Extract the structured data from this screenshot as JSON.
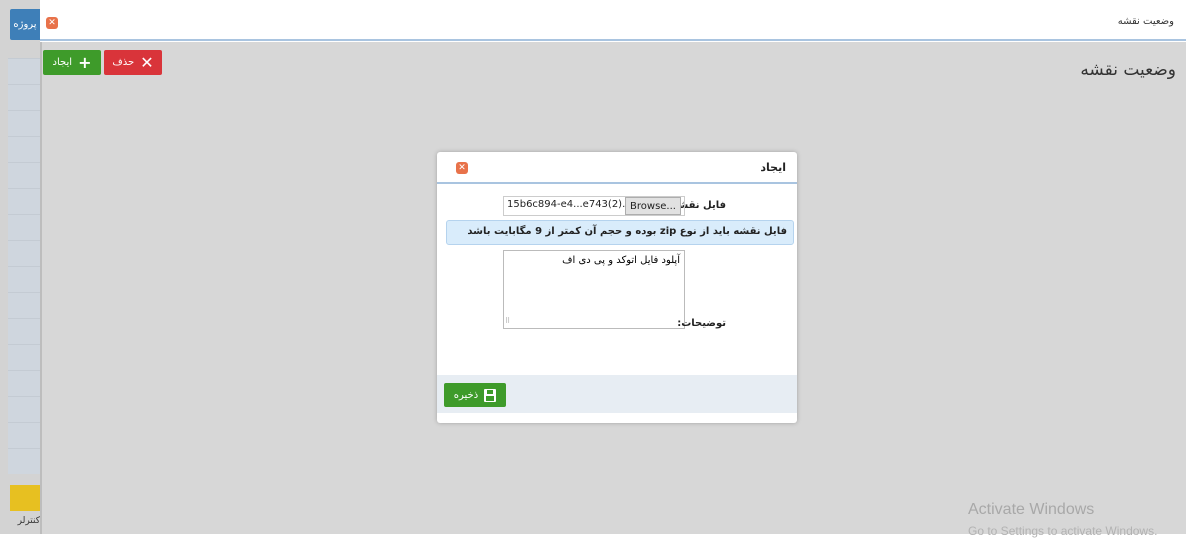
{
  "sidebar": {
    "project_tab": "پروژه",
    "bottom_label": "کنترلر"
  },
  "tab": {
    "title": "وضعیت نقشه"
  },
  "page": {
    "title": "وضعیت نقشه"
  },
  "toolbar": {
    "add_label": "ایجاد",
    "delete_label": "حذف"
  },
  "modal": {
    "title": "ایجاد",
    "file_label": "فایل نقشه:",
    "file_name": "15b6c894-e4...e743(2).zip",
    "browse_label": "Browse...",
    "info_text": "فایل نقشه باید از نوع zip بوده و حجم آن کمتر از 9 مگابایت باشد",
    "description_value": "آپلود فایل اتوکد و پی دی اف",
    "description_label": "توضیحات:",
    "save_label": "ذخیره"
  },
  "watermark": {
    "title": "Activate Windows",
    "subtitle": "Go to Settings to activate Windows."
  },
  "colors": {
    "primary_blue": "#3e7fb8",
    "success_green": "#3e9b2a",
    "danger_red": "#d9343a",
    "close_orange": "#e8724a",
    "info_bg": "#d9ecfb"
  }
}
